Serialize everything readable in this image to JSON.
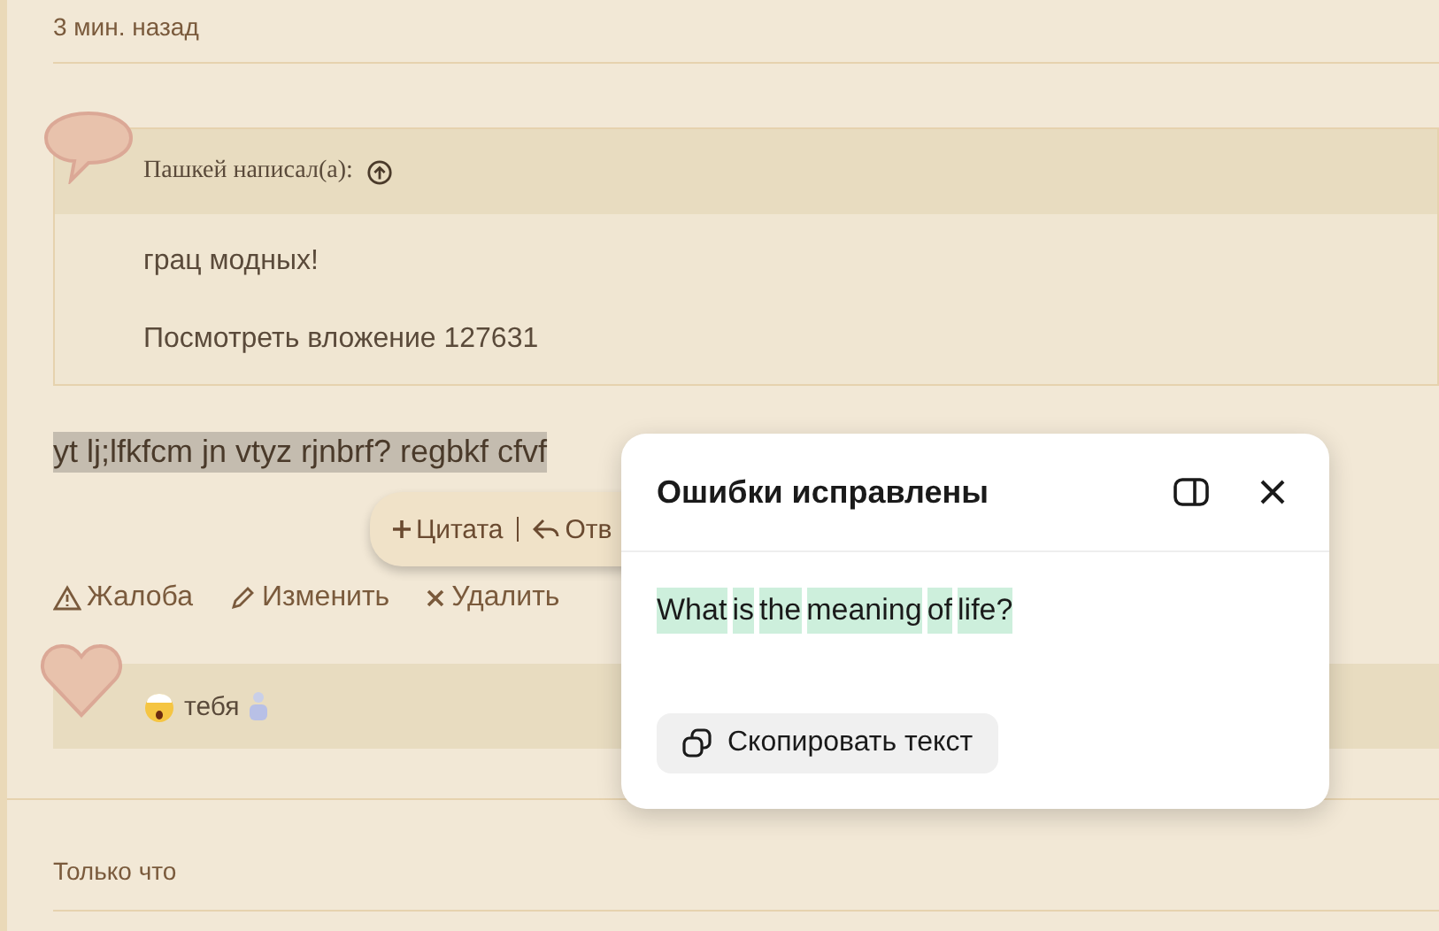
{
  "posts": [
    {
      "time": "3 мин. назад"
    }
  ],
  "quote": {
    "author": "Пашкей написал(а):",
    "lines": [
      "грац модных!",
      "Посмотреть вложение 127631"
    ]
  },
  "message": {
    "text": "yt lj;lfkfcm jn vtyz rjnbrf? regbkf cfvf",
    "selected": true
  },
  "selection_toolbar": {
    "items": [
      {
        "kind": "plus",
        "label": "Цитата"
      },
      {
        "kind": "reply",
        "label": "Отв"
      }
    ]
  },
  "actions": [
    {
      "kind": "warning",
      "label": "Жалоба"
    },
    {
      "kind": "edit",
      "label": "Изменить"
    },
    {
      "kind": "delete",
      "label": "Удалить"
    }
  ],
  "signature": {
    "text": "тебя"
  },
  "next_post": {
    "time": "Только что"
  },
  "popup": {
    "title": "Ошибки исправлены",
    "words": [
      "What",
      "is",
      "the",
      "meaning",
      "of",
      "life?"
    ],
    "copy_button": "Скопировать текст"
  }
}
